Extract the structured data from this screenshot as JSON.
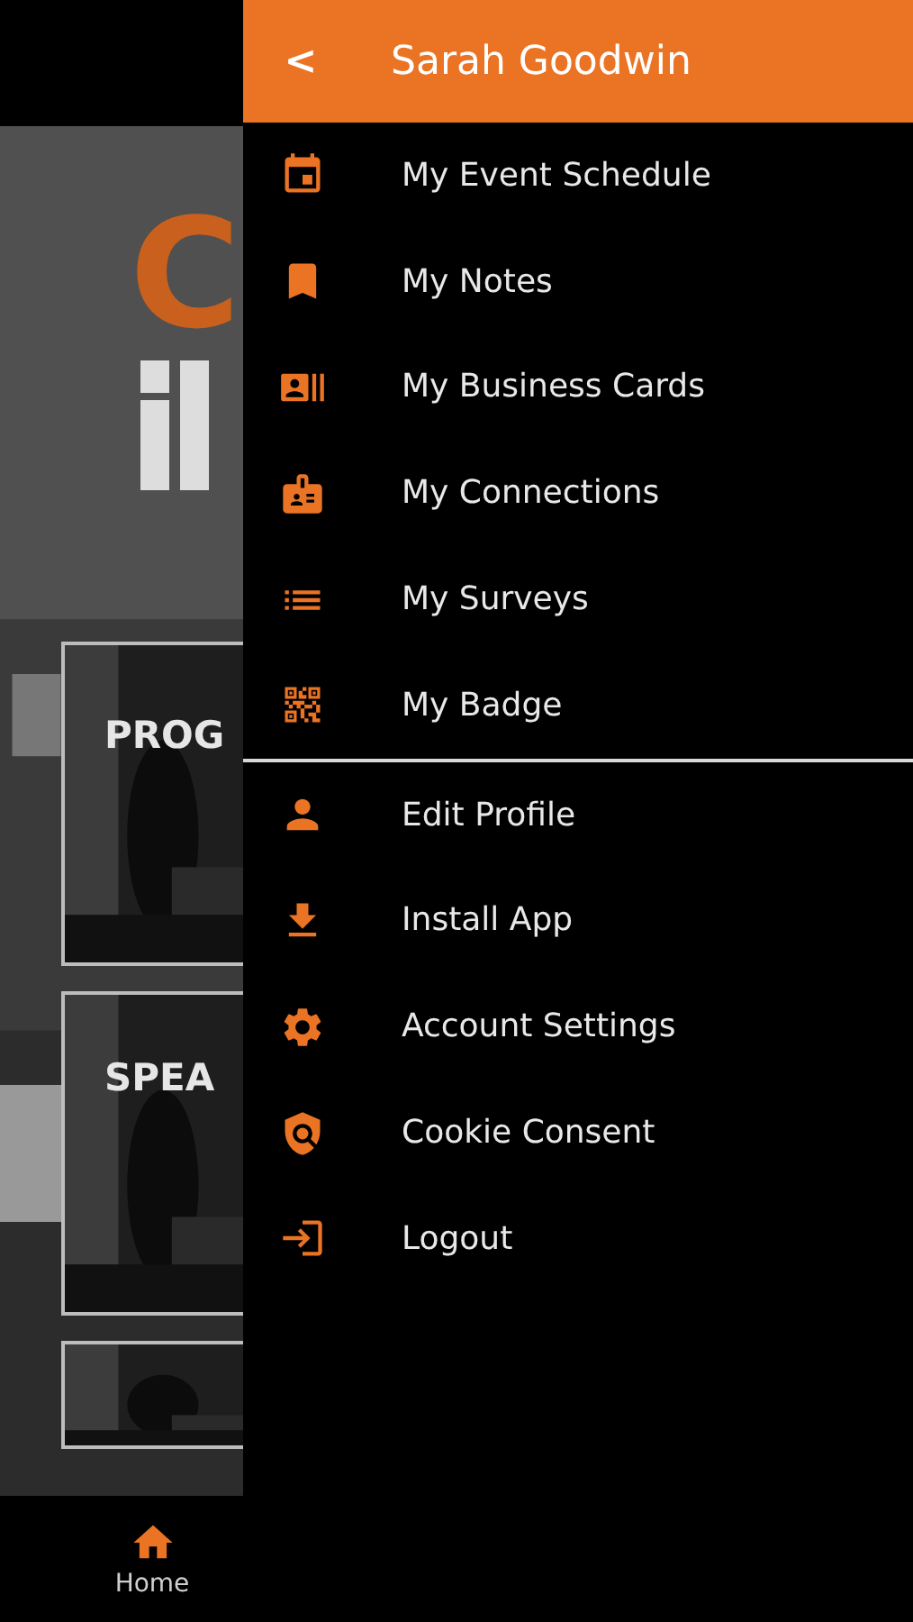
{
  "background": {
    "logo_letter": "C",
    "cards": [
      {
        "label": "PROG"
      },
      {
        "label": "SPEA"
      }
    ]
  },
  "bottom_nav": {
    "items": [
      {
        "label": "Home",
        "selected": true
      }
    ]
  },
  "drawer": {
    "header": {
      "back": "<",
      "title": "Sarah Goodwin"
    },
    "primary_items": [
      {
        "label": "My Event Schedule"
      },
      {
        "label": "My Notes"
      },
      {
        "label": "My Business Cards"
      },
      {
        "label": "My Connections"
      },
      {
        "label": "My Surveys"
      },
      {
        "label": "My Badge"
      }
    ],
    "secondary_items": [
      {
        "label": "Edit Profile"
      },
      {
        "label": "Install App"
      },
      {
        "label": "Account Settings"
      },
      {
        "label": "Cookie Consent"
      },
      {
        "label": "Logout"
      }
    ]
  }
}
